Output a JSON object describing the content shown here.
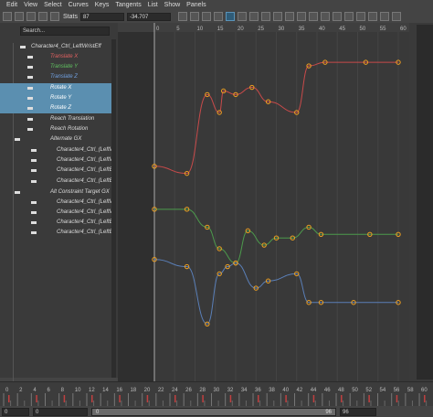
{
  "menu": [
    "Edit",
    "View",
    "Select",
    "Curves",
    "Keys",
    "Tangents",
    "List",
    "Show",
    "Panels"
  ],
  "toolbar": {
    "stats_label": "Stats",
    "stats_frame": "87",
    "stats_value": "-34.707"
  },
  "outliner": {
    "search_placeholder": "Search...",
    "items": [
      {
        "label": "Character4_Ctrl_LeftWristEff",
        "color": "#dddddd",
        "selected": false,
        "icon": "transform-icon"
      },
      {
        "label": "Translate X",
        "color": "#e06060",
        "selected": false,
        "icon": "key-icon"
      },
      {
        "label": "Translate Y",
        "color": "#60c060",
        "selected": false,
        "icon": "key-icon"
      },
      {
        "label": "Translate Z",
        "color": "#70a0e0",
        "selected": false,
        "icon": "key-icon"
      },
      {
        "label": "Rotate X",
        "color": "#ffffff",
        "selected": true,
        "icon": "key-icon"
      },
      {
        "label": "Rotate Y",
        "color": "#ffffff",
        "selected": true,
        "icon": "key-icon"
      },
      {
        "label": "Rotate Z",
        "color": "#ffffff",
        "selected": true,
        "icon": "key-icon"
      },
      {
        "label": "Reach Translation",
        "color": "#dddddd",
        "selected": false,
        "icon": "key-icon"
      },
      {
        "label": "Reach Rotation",
        "color": "#dddddd",
        "selected": false,
        "icon": "key-icon"
      },
      {
        "label": "Alternate GX",
        "color": "#dddddd",
        "selected": false,
        "icon": "group-icon"
      },
      {
        "label": "Character4_Ctrl_(LeftWri",
        "color": "#dddddd",
        "selected": false,
        "icon": "key-icon"
      },
      {
        "label": "Character4_Ctrl_(LeftWri",
        "color": "#dddddd",
        "selected": false,
        "icon": "key-icon"
      },
      {
        "label": "Character4_Ctrl_(LeftElbo",
        "color": "#dddddd",
        "selected": false,
        "icon": "key-icon"
      },
      {
        "label": "Character4_Ctrl_(LeftElbo",
        "color": "#dddddd",
        "selected": false,
        "icon": "key-icon"
      },
      {
        "label": "Alt Constraint Target GX",
        "color": "#dddddd",
        "selected": false,
        "icon": "group-icon"
      },
      {
        "label": "Character4_Ctrl_(LeftWri",
        "color": "#dddddd",
        "selected": false,
        "icon": "key-icon"
      },
      {
        "label": "Character4_Ctrl_(LeftWri",
        "color": "#dddddd",
        "selected": false,
        "icon": "key-icon"
      },
      {
        "label": "Character4_Ctrl_(LeftElbo",
        "color": "#dddddd",
        "selected": false,
        "icon": "key-icon"
      },
      {
        "label": "Character4_Ctrl_(LeftElbo",
        "color": "#dddddd",
        "selected": false,
        "icon": "key-icon"
      }
    ]
  },
  "graph": {
    "ruler_labels": [
      "0",
      "5",
      "10",
      "15",
      "20",
      "25",
      "30",
      "35",
      "40",
      "45",
      "50",
      "55",
      "60"
    ],
    "current_frame": 0,
    "curves": [
      {
        "name": "Rotate X",
        "color": "#c84a4a",
        "keys": [
          [
            0,
            60
          ],
          [
            8,
            58
          ],
          [
            13,
            80
          ],
          [
            16,
            75
          ],
          [
            17,
            81
          ],
          [
            20,
            80
          ],
          [
            24,
            82
          ],
          [
            28,
            78
          ],
          [
            35,
            75
          ],
          [
            38,
            88
          ],
          [
            42,
            89
          ],
          [
            52,
            89
          ],
          [
            60,
            89
          ]
        ]
      },
      {
        "name": "Rotate Y",
        "color": "#4c9a4c",
        "keys": [
          [
            0,
            48
          ],
          [
            8,
            48
          ],
          [
            13,
            43
          ],
          [
            16,
            37
          ],
          [
            20,
            33
          ],
          [
            23,
            42
          ],
          [
            27,
            38
          ],
          [
            30,
            40
          ],
          [
            34,
            40
          ],
          [
            38,
            43
          ],
          [
            41,
            41
          ],
          [
            53,
            41
          ],
          [
            60,
            41
          ]
        ]
      },
      {
        "name": "Rotate Z",
        "color": "#5a7fb8",
        "keys": [
          [
            0,
            34
          ],
          [
            8,
            32
          ],
          [
            13,
            16
          ],
          [
            16,
            30
          ],
          [
            18,
            32
          ],
          [
            20,
            33
          ],
          [
            25,
            26
          ],
          [
            28,
            28
          ],
          [
            35,
            30
          ],
          [
            38,
            22
          ],
          [
            41,
            22
          ],
          [
            49,
            22
          ],
          [
            60,
            22
          ]
        ]
      }
    ],
    "key_color": "#f0a020"
  },
  "timeline": {
    "labels": [
      "0",
      "2",
      "4",
      "6",
      "8",
      "10",
      "12",
      "14",
      "16",
      "18",
      "20",
      "22",
      "24",
      "26",
      "28",
      "30",
      "32",
      "34",
      "36",
      "38",
      "40",
      "42",
      "44",
      "46",
      "48",
      "50",
      "52",
      "54",
      "56",
      "58",
      "60"
    ],
    "start": "0",
    "end": "96"
  },
  "range": {
    "start": "0",
    "slider_start": "0",
    "slider_end": "96",
    "end": "96"
  }
}
